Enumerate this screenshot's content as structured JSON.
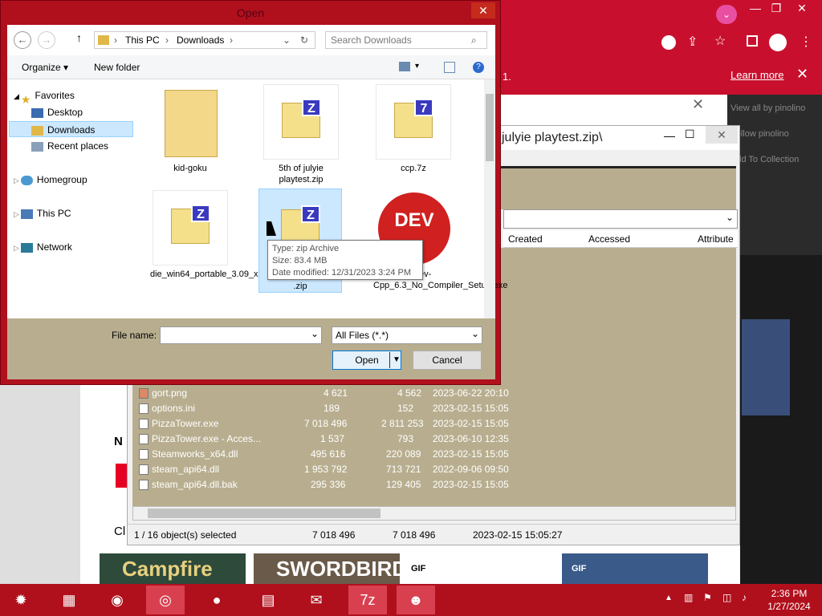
{
  "browser": {
    "notice_link": "Learn more",
    "notice_fragment": "1.",
    "pin_items": [
      "View all by pinolino",
      "Follow pinolino",
      "Add To Collection"
    ],
    "thumbs": [
      "Campfire",
      "SWORDBIRD",
      "GIF",
      "GIF"
    ],
    "page_fragment_n": "N",
    "page_fragment_c": "Cl"
  },
  "sevenzip": {
    "title": "julyie playtest.zip\\",
    "columns": [
      "Created",
      "Accessed",
      "Attribute"
    ],
    "files": [
      {
        "name": "gort.png",
        "size": "4 621",
        "packed": "4 562",
        "modified": "2023-06-22 20:10"
      },
      {
        "name": "options.ini",
        "size": "189",
        "packed": "152",
        "modified": "2023-02-15 15:05"
      },
      {
        "name": "PizzaTower.exe",
        "size": "7 018 496",
        "packed": "2 811 253",
        "modified": "2023-02-15 15:05"
      },
      {
        "name": "PizzaTower.exe - Acces...",
        "size": "1 537",
        "packed": "793",
        "modified": "2023-06-10 12:35"
      },
      {
        "name": "Steamworks_x64.dll",
        "size": "495 616",
        "packed": "220 089",
        "modified": "2023-02-15 15:05"
      },
      {
        "name": "steam_api64.dll",
        "size": "1 953 792",
        "packed": "713 721",
        "modified": "2022-09-06 09:50"
      },
      {
        "name": "steam_api64.dll.bak",
        "size": "295 336",
        "packed": "129 405",
        "modified": "2023-02-15 15:05"
      }
    ],
    "status": {
      "selected": "1 / 16 object(s) selected",
      "size": "7 018 496",
      "packed": "7 018 496",
      "modified": "2023-02-15 15:05:27"
    }
  },
  "dialog": {
    "title": "Open",
    "breadcrumb": [
      "This PC",
      "Downloads"
    ],
    "search_placeholder": "Search Downloads",
    "organize": "Organize ▾",
    "new_folder": "New folder",
    "tree": {
      "favorites": "Favorites",
      "desktop": "Desktop",
      "downloads": "Downloads",
      "recent": "Recent places",
      "homegroup": "Homegroup",
      "this_pc": "This PC",
      "network": "Network"
    },
    "files": [
      {
        "name": "kid-goku",
        "kind": "folder"
      },
      {
        "name": "5th of julyie playtest.zip",
        "kind": "zip"
      },
      {
        "name": "ccp.7z",
        "kind": "7z"
      },
      {
        "name": "die_win64_portable_3.09_x64.zip",
        "kind": "zip"
      },
      {
        "name": ".zip",
        "kind": "zip"
      },
      {
        "name": "...o_Dev-Cpp_6.3_No_Compiler_Setup.exe",
        "kind": "exe"
      }
    ],
    "tooltip": {
      "type": "Type: zip Archive",
      "size": "Size: 83.4 MB",
      "date": "Date modified: 12/31/2023 3:24 PM"
    },
    "file_name_label": "File name:",
    "file_name_value": "",
    "filter": "All Files (*.*)",
    "open": "Open",
    "cancel": "Cancel"
  },
  "taskbar": {
    "time": "2:36 PM",
    "date": "1/27/2024"
  },
  "colors": {
    "accent": "#c8102e",
    "olive": "#b8ae8f"
  }
}
